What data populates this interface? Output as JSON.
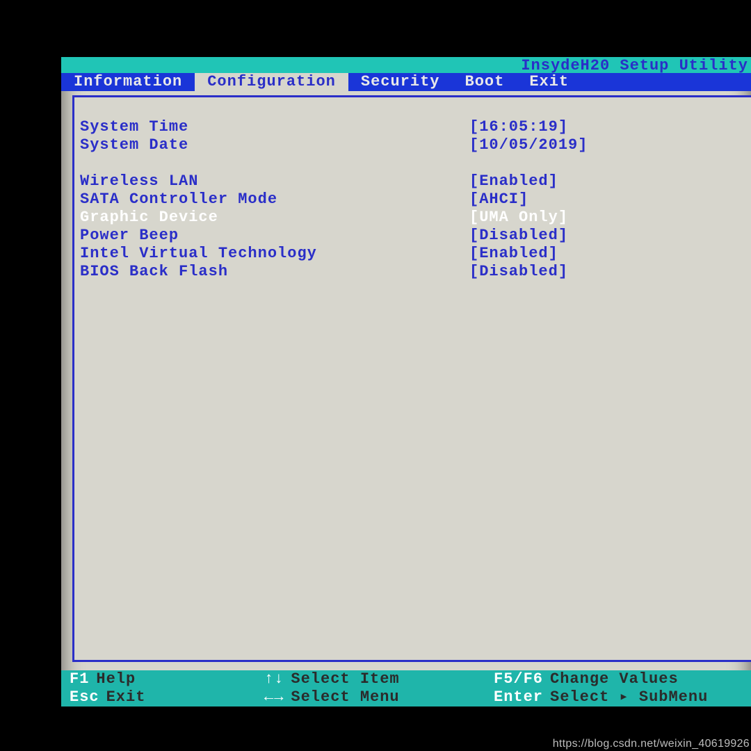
{
  "title": "InsydeH20 Setup Utility",
  "tabs": [
    {
      "label": "Information",
      "active": false
    },
    {
      "label": "Configuration",
      "active": true
    },
    {
      "label": "Security",
      "active": false
    },
    {
      "label": "Boot",
      "active": false
    },
    {
      "label": "Exit",
      "active": false
    }
  ],
  "groups": [
    [
      {
        "label": "System Time",
        "value": "[16:05:19]",
        "selected": false
      },
      {
        "label": "System Date",
        "value": "[10/05/2019]",
        "selected": false
      }
    ],
    [
      {
        "label": "Wireless LAN",
        "value": "[Enabled]",
        "selected": false
      },
      {
        "label": "SATA Controller Mode",
        "value": "[AHCI]",
        "selected": false
      },
      {
        "label": "Graphic Device",
        "value": "[UMA Only]",
        "selected": true
      },
      {
        "label": "Power Beep",
        "value": "[Disabled]",
        "selected": false
      },
      {
        "label": "Intel Virtual Technology",
        "value": "[Enabled]",
        "selected": false
      },
      {
        "label": "BIOS Back Flash",
        "value": "[Disabled]",
        "selected": false
      }
    ]
  ],
  "footer": {
    "line1": {
      "left_key": "F1",
      "left_act": "Help",
      "mid_key": "↑↓",
      "mid_act": "Select Item",
      "right_key": "F5/F6",
      "right_act": "Change Values"
    },
    "line2": {
      "left_key": "Esc",
      "left_act": "Exit",
      "mid_key": "←→",
      "mid_act": "Select Menu",
      "right_key": "Enter",
      "right_act": "Select ▸ SubMenu"
    }
  },
  "watermark": "https://blog.csdn.net/weixin_40619926",
  "colors": {
    "accent_blue": "#2a2ec8",
    "tab_blue": "#1a35d8",
    "teal": "#20c5b6",
    "panel": "#d7d6cd",
    "white": "#ffffff"
  }
}
